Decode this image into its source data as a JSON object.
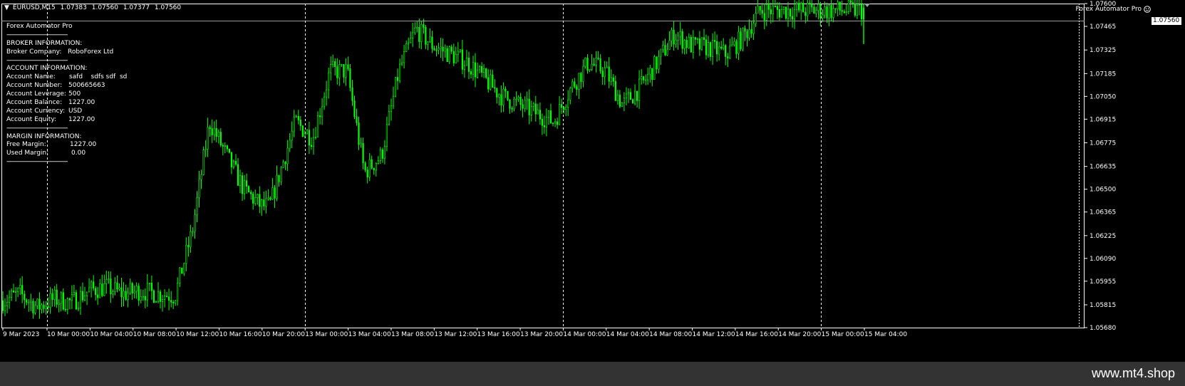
{
  "header": {
    "symbol": "EURUSD,M15",
    "open": "1.07383",
    "high": "1.07560",
    "low": "1.07377",
    "close": "1.07560",
    "ea_name": "Forex Automator Pro"
  },
  "info_panel": {
    "title": "Forex Automator Pro",
    "separator": "--------------------------------------",
    "broker_heading": "BROKER INFORMATION:",
    "broker_company_label": "Broker Company:",
    "broker_company_value": "RoboForex Ltd",
    "account_heading": "ACCOUNT INFORMATION:",
    "account_name_label": "Account Name:",
    "account_name_value": "safd    sdfs sdf  sd",
    "account_number_label": "Account Number:",
    "account_number_value": "500665663",
    "account_leverage_label": "Account Leverage:",
    "account_leverage_value": "500",
    "account_balance_label": "Account Balance:",
    "account_balance_value": "1227.00",
    "account_currency_label": "Account Currency:",
    "account_currency_value": "USD",
    "account_equity_label": "Account Equity:",
    "account_equity_value": "1227.00",
    "margin_heading": "MARGIN INFORMATION:",
    "free_margin_label": "Free Margin:",
    "free_margin_value": "1227.00",
    "used_margin_label": "Used Margin:",
    "used_margin_value": "0.00"
  },
  "price_axis": {
    "ticks": [
      "1.07600",
      "1.07465",
      "1.07325",
      "1.07185",
      "1.07050",
      "1.06915",
      "1.06775",
      "1.06635",
      "1.06500",
      "1.06365",
      "1.06225",
      "1.06090",
      "1.05955",
      "1.05815",
      "1.05680"
    ],
    "current_price": "1.07560"
  },
  "time_axis": {
    "ticks": [
      "9 Mar 2023",
      "10 Mar 00:00",
      "10 Mar 04:00",
      "10 Mar 08:00",
      "10 Mar 12:00",
      "10 Mar 16:00",
      "10 Mar 20:00",
      "13 Mar 00:00",
      "13 Mar 04:00",
      "13 Mar 08:00",
      "13 Mar 12:00",
      "13 Mar 16:00",
      "13 Mar 20:00",
      "14 Mar 00:00",
      "14 Mar 04:00",
      "14 Mar 08:00",
      "14 Mar 12:00",
      "14 Mar 16:00",
      "14 Mar 20:00",
      "15 Mar 00:00",
      "15 Mar 04:00"
    ]
  },
  "colors": {
    "background": "#000000",
    "candles": "#00ff00",
    "grid": "#ffffff",
    "text": "#ffffff"
  },
  "watermark": "www.mt4.shop",
  "chart_data": {
    "type": "candlestick",
    "symbol": "EURUSD",
    "timeframe": "M15",
    "ylim": [
      1.0568,
      1.076
    ],
    "path": [
      [
        0,
        1.0584
      ],
      [
        0.02,
        1.0588
      ],
      [
        0.04,
        1.058
      ],
      [
        0.06,
        1.0585
      ],
      [
        0.08,
        1.0583
      ],
      [
        0.1,
        1.059
      ],
      [
        0.12,
        1.0592
      ],
      [
        0.14,
        1.0588
      ],
      [
        0.16,
        1.059
      ],
      [
        0.18,
        1.0588
      ],
      [
        0.2,
        1.0587
      ],
      [
        0.22,
        1.0625
      ],
      [
        0.24,
        1.069
      ],
      [
        0.26,
        1.067
      ],
      [
        0.28,
        1.065
      ],
      [
        0.3,
        1.064
      ],
      [
        0.31,
        1.064
      ],
      [
        0.34,
        1.069
      ],
      [
        0.36,
        1.068
      ],
      [
        0.38,
        1.072
      ],
      [
        0.4,
        1.072
      ],
      [
        0.42,
        1.066
      ],
      [
        0.44,
        1.067
      ],
      [
        0.46,
        1.072
      ],
      [
        0.48,
        1.0745
      ],
      [
        0.5,
        1.0735
      ],
      [
        0.52,
        1.073
      ],
      [
        0.54,
        1.0725
      ],
      [
        0.56,
        1.0715
      ],
      [
        0.58,
        1.0705
      ],
      [
        0.6,
        1.07
      ],
      [
        0.62,
        1.0695
      ],
      [
        0.64,
        1.069
      ],
      [
        0.66,
        1.071
      ],
      [
        0.68,
        1.0725
      ],
      [
        0.7,
        1.072
      ],
      [
        0.72,
        1.07
      ],
      [
        0.74,
        1.071
      ],
      [
        0.76,
        1.0725
      ],
      [
        0.78,
        1.0742
      ],
      [
        0.8,
        1.0735
      ],
      [
        0.82,
        1.0734
      ],
      [
        0.84,
        1.073
      ],
      [
        0.86,
        1.074
      ],
      [
        0.88,
        1.0756
      ]
    ]
  }
}
